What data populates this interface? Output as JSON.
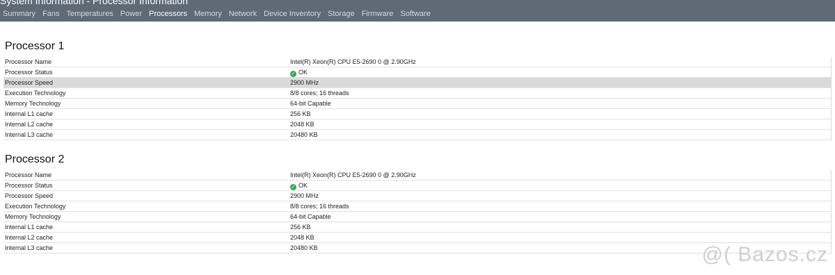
{
  "window": {
    "title": "System Information - Processor Information"
  },
  "tabs": [
    {
      "label": "Summary"
    },
    {
      "label": "Fans"
    },
    {
      "label": "Temperatures"
    },
    {
      "label": "Power"
    },
    {
      "label": "Processors"
    },
    {
      "label": "Memory"
    },
    {
      "label": "Network"
    },
    {
      "label": "Device Inventory"
    },
    {
      "label": "Storage"
    },
    {
      "label": "Firmware"
    },
    {
      "label": "Software"
    }
  ],
  "active_tab": "Processors",
  "processors": [
    {
      "title": "Processor 1",
      "rows": [
        {
          "label": "Processor Name",
          "value": "Intel(R) Xeon(R) CPU E5-2690 0 @ 2.90GHz"
        },
        {
          "label": "Processor Status",
          "value": "OK"
        },
        {
          "label": "Processor Speed",
          "value": "2900 MHz"
        },
        {
          "label": "Execution Technology",
          "value": "8/8 cores; 16 threads"
        },
        {
          "label": "Memory Technology",
          "value": "64-bit Capable"
        },
        {
          "label": "Internal L1 cache",
          "value": "256 KB"
        },
        {
          "label": "Internal L2 cache",
          "value": "2048 KB"
        },
        {
          "label": "Internal L3 cache",
          "value": "20480 KB"
        }
      ]
    },
    {
      "title": "Processor 2",
      "rows": [
        {
          "label": "Processor Name",
          "value": "Intel(R) Xeon(R) CPU E5-2690 0 @ 2.90GHz"
        },
        {
          "label": "Processor Status",
          "value": "OK"
        },
        {
          "label": "Processor Speed",
          "value": "2900 MHz"
        },
        {
          "label": "Execution Technology",
          "value": "8/8 cores; 16 threads"
        },
        {
          "label": "Memory Technology",
          "value": "64-bit Capable"
        },
        {
          "label": "Internal L1 cache",
          "value": "256 KB"
        },
        {
          "label": "Internal L2 cache",
          "value": "2048 KB"
        },
        {
          "label": "Internal L3 cache",
          "value": "20480 KB"
        }
      ]
    }
  ],
  "status_icon": "check-circle-icon",
  "colors": {
    "header_bg": "#5e6a76",
    "status_ok": "#32a852",
    "highlight_row": "#dadada"
  },
  "watermark": "@( Bazos.cz"
}
